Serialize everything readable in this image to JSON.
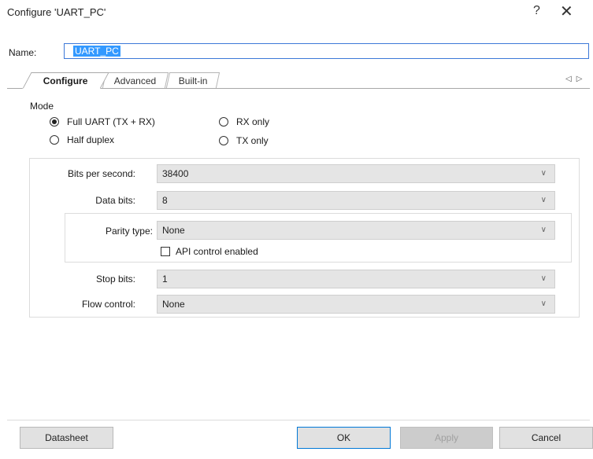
{
  "window": {
    "title": "Configure 'UART_PC'",
    "help_glyph": "?",
    "close_glyph": "✕"
  },
  "name_row": {
    "label": "Name:",
    "value": "UART_PC"
  },
  "tabs": [
    {
      "label": "Configure",
      "active": true
    },
    {
      "label": "Advanced",
      "active": false
    },
    {
      "label": "Built-in",
      "active": false
    }
  ],
  "tab_scroll_arrows": "◁▷",
  "mode": {
    "label": "Mode",
    "options": [
      {
        "label": "Full UART (TX + RX)",
        "selected": true
      },
      {
        "label": "Half duplex",
        "selected": false
      },
      {
        "label": "RX only",
        "selected": false
      },
      {
        "label": "TX only",
        "selected": false
      }
    ]
  },
  "fields": {
    "bits_per_second": {
      "label": "Bits per second:",
      "value": "38400"
    },
    "data_bits": {
      "label": "Data bits:",
      "value": "8"
    },
    "parity_type": {
      "label": "Parity type:",
      "value": "None"
    },
    "api_control": {
      "label": "API control enabled",
      "checked": false
    },
    "stop_bits": {
      "label": "Stop bits:",
      "value": "1"
    },
    "flow_control": {
      "label": "Flow control:",
      "value": "None"
    }
  },
  "chevron_glyph": "∨",
  "buttons": {
    "datasheet": "Datasheet",
    "ok": "OK",
    "apply": "Apply",
    "cancel": "Cancel"
  },
  "colors": {
    "selection": "#3399ff",
    "focus_border": "#0078d7",
    "combo_bg": "#e5e5e5"
  }
}
